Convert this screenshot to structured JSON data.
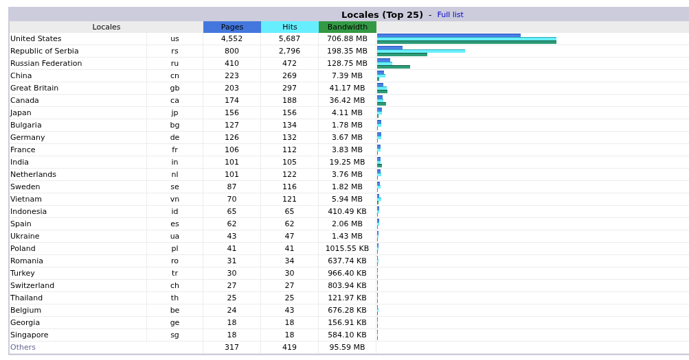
{
  "title": "Locales (Top 25)",
  "separator": "-",
  "full_list_link": "Full list",
  "columns": [
    {
      "label": "Locales",
      "kind": "name"
    },
    {
      "label": "Pages",
      "kind": "pages"
    },
    {
      "label": "Hits",
      "kind": "hits"
    },
    {
      "label": "Bandwidth",
      "kind": "bandwidth"
    }
  ],
  "rows": [
    {
      "name": "United States",
      "code": "us",
      "pages": "4,552",
      "hits": "5,687",
      "bandwidth": "706.88 MB"
    },
    {
      "name": "Republic of Serbia",
      "code": "rs",
      "pages": "800",
      "hits": "2,796",
      "bandwidth": "198.35 MB"
    },
    {
      "name": "Russian Federation",
      "code": "ru",
      "pages": "410",
      "hits": "472",
      "bandwidth": "128.75 MB"
    },
    {
      "name": "China",
      "code": "cn",
      "pages": "223",
      "hits": "269",
      "bandwidth": "7.39 MB"
    },
    {
      "name": "Great Britain",
      "code": "gb",
      "pages": "203",
      "hits": "297",
      "bandwidth": "41.17 MB"
    },
    {
      "name": "Canada",
      "code": "ca",
      "pages": "174",
      "hits": "188",
      "bandwidth": "36.42 MB"
    },
    {
      "name": "Japan",
      "code": "jp",
      "pages": "156",
      "hits": "156",
      "bandwidth": "4.11 MB"
    },
    {
      "name": "Bulgaria",
      "code": "bg",
      "pages": "127",
      "hits": "134",
      "bandwidth": "1.78 MB"
    },
    {
      "name": "Germany",
      "code": "de",
      "pages": "126",
      "hits": "132",
      "bandwidth": "3.67 MB"
    },
    {
      "name": "France",
      "code": "fr",
      "pages": "106",
      "hits": "112",
      "bandwidth": "3.83 MB"
    },
    {
      "name": "India",
      "code": "in",
      "pages": "101",
      "hits": "105",
      "bandwidth": "19.25 MB"
    },
    {
      "name": "Netherlands",
      "code": "nl",
      "pages": "101",
      "hits": "122",
      "bandwidth": "3.76 MB"
    },
    {
      "name": "Sweden",
      "code": "se",
      "pages": "87",
      "hits": "116",
      "bandwidth": "1.82 MB"
    },
    {
      "name": "Vietnam",
      "code": "vn",
      "pages": "70",
      "hits": "121",
      "bandwidth": "5.94 MB"
    },
    {
      "name": "Indonesia",
      "code": "id",
      "pages": "65",
      "hits": "65",
      "bandwidth": "410.49 KB"
    },
    {
      "name": "Spain",
      "code": "es",
      "pages": "62",
      "hits": "62",
      "bandwidth": "2.06 MB"
    },
    {
      "name": "Ukraine",
      "code": "ua",
      "pages": "43",
      "hits": "47",
      "bandwidth": "1.43 MB"
    },
    {
      "name": "Poland",
      "code": "pl",
      "pages": "41",
      "hits": "41",
      "bandwidth": "1015.55 KB"
    },
    {
      "name": "Romania",
      "code": "ro",
      "pages": "31",
      "hits": "34",
      "bandwidth": "637.74 KB"
    },
    {
      "name": "Turkey",
      "code": "tr",
      "pages": "30",
      "hits": "30",
      "bandwidth": "966.40 KB"
    },
    {
      "name": "Switzerland",
      "code": "ch",
      "pages": "27",
      "hits": "27",
      "bandwidth": "803.94 KB"
    },
    {
      "name": "Thailand",
      "code": "th",
      "pages": "25",
      "hits": "25",
      "bandwidth": "121.97 KB"
    },
    {
      "name": "Belgium",
      "code": "be",
      "pages": "24",
      "hits": "43",
      "bandwidth": "676.28 KB"
    },
    {
      "name": "Georgia",
      "code": "ge",
      "pages": "18",
      "hits": "18",
      "bandwidth": "156.91 KB"
    },
    {
      "name": "Singapore",
      "code": "sg",
      "pages": "18",
      "hits": "18",
      "bandwidth": "584.10 KB"
    }
  ],
  "others": {
    "label": "Others",
    "pages": "317",
    "hits": "419",
    "bandwidth": "95.59 MB"
  }
}
